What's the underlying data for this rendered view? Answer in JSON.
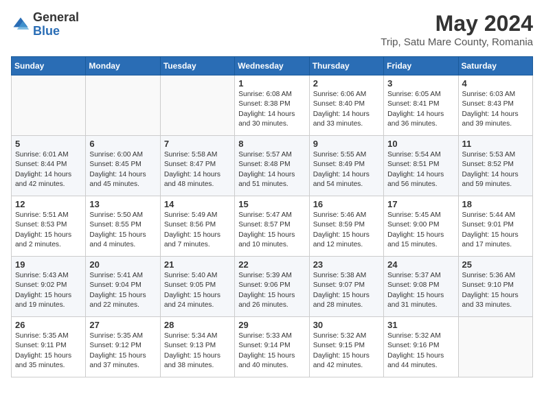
{
  "logo": {
    "general": "General",
    "blue": "Blue"
  },
  "title": "May 2024",
  "subtitle": "Trip, Satu Mare County, Romania",
  "days_of_week": [
    "Sunday",
    "Monday",
    "Tuesday",
    "Wednesday",
    "Thursday",
    "Friday",
    "Saturday"
  ],
  "weeks": [
    [
      {
        "day": "",
        "detail": ""
      },
      {
        "day": "",
        "detail": ""
      },
      {
        "day": "",
        "detail": ""
      },
      {
        "day": "1",
        "detail": "Sunrise: 6:08 AM\nSunset: 8:38 PM\nDaylight: 14 hours\nand 30 minutes."
      },
      {
        "day": "2",
        "detail": "Sunrise: 6:06 AM\nSunset: 8:40 PM\nDaylight: 14 hours\nand 33 minutes."
      },
      {
        "day": "3",
        "detail": "Sunrise: 6:05 AM\nSunset: 8:41 PM\nDaylight: 14 hours\nand 36 minutes."
      },
      {
        "day": "4",
        "detail": "Sunrise: 6:03 AM\nSunset: 8:43 PM\nDaylight: 14 hours\nand 39 minutes."
      }
    ],
    [
      {
        "day": "5",
        "detail": "Sunrise: 6:01 AM\nSunset: 8:44 PM\nDaylight: 14 hours\nand 42 minutes."
      },
      {
        "day": "6",
        "detail": "Sunrise: 6:00 AM\nSunset: 8:45 PM\nDaylight: 14 hours\nand 45 minutes."
      },
      {
        "day": "7",
        "detail": "Sunrise: 5:58 AM\nSunset: 8:47 PM\nDaylight: 14 hours\nand 48 minutes."
      },
      {
        "day": "8",
        "detail": "Sunrise: 5:57 AM\nSunset: 8:48 PM\nDaylight: 14 hours\nand 51 minutes."
      },
      {
        "day": "9",
        "detail": "Sunrise: 5:55 AM\nSunset: 8:49 PM\nDaylight: 14 hours\nand 54 minutes."
      },
      {
        "day": "10",
        "detail": "Sunrise: 5:54 AM\nSunset: 8:51 PM\nDaylight: 14 hours\nand 56 minutes."
      },
      {
        "day": "11",
        "detail": "Sunrise: 5:53 AM\nSunset: 8:52 PM\nDaylight: 14 hours\nand 59 minutes."
      }
    ],
    [
      {
        "day": "12",
        "detail": "Sunrise: 5:51 AM\nSunset: 8:53 PM\nDaylight: 15 hours\nand 2 minutes."
      },
      {
        "day": "13",
        "detail": "Sunrise: 5:50 AM\nSunset: 8:55 PM\nDaylight: 15 hours\nand 4 minutes."
      },
      {
        "day": "14",
        "detail": "Sunrise: 5:49 AM\nSunset: 8:56 PM\nDaylight: 15 hours\nand 7 minutes."
      },
      {
        "day": "15",
        "detail": "Sunrise: 5:47 AM\nSunset: 8:57 PM\nDaylight: 15 hours\nand 10 minutes."
      },
      {
        "day": "16",
        "detail": "Sunrise: 5:46 AM\nSunset: 8:59 PM\nDaylight: 15 hours\nand 12 minutes."
      },
      {
        "day": "17",
        "detail": "Sunrise: 5:45 AM\nSunset: 9:00 PM\nDaylight: 15 hours\nand 15 minutes."
      },
      {
        "day": "18",
        "detail": "Sunrise: 5:44 AM\nSunset: 9:01 PM\nDaylight: 15 hours\nand 17 minutes."
      }
    ],
    [
      {
        "day": "19",
        "detail": "Sunrise: 5:43 AM\nSunset: 9:02 PM\nDaylight: 15 hours\nand 19 minutes."
      },
      {
        "day": "20",
        "detail": "Sunrise: 5:41 AM\nSunset: 9:04 PM\nDaylight: 15 hours\nand 22 minutes."
      },
      {
        "day": "21",
        "detail": "Sunrise: 5:40 AM\nSunset: 9:05 PM\nDaylight: 15 hours\nand 24 minutes."
      },
      {
        "day": "22",
        "detail": "Sunrise: 5:39 AM\nSunset: 9:06 PM\nDaylight: 15 hours\nand 26 minutes."
      },
      {
        "day": "23",
        "detail": "Sunrise: 5:38 AM\nSunset: 9:07 PM\nDaylight: 15 hours\nand 28 minutes."
      },
      {
        "day": "24",
        "detail": "Sunrise: 5:37 AM\nSunset: 9:08 PM\nDaylight: 15 hours\nand 31 minutes."
      },
      {
        "day": "25",
        "detail": "Sunrise: 5:36 AM\nSunset: 9:10 PM\nDaylight: 15 hours\nand 33 minutes."
      }
    ],
    [
      {
        "day": "26",
        "detail": "Sunrise: 5:35 AM\nSunset: 9:11 PM\nDaylight: 15 hours\nand 35 minutes."
      },
      {
        "day": "27",
        "detail": "Sunrise: 5:35 AM\nSunset: 9:12 PM\nDaylight: 15 hours\nand 37 minutes."
      },
      {
        "day": "28",
        "detail": "Sunrise: 5:34 AM\nSunset: 9:13 PM\nDaylight: 15 hours\nand 38 minutes."
      },
      {
        "day": "29",
        "detail": "Sunrise: 5:33 AM\nSunset: 9:14 PM\nDaylight: 15 hours\nand 40 minutes."
      },
      {
        "day": "30",
        "detail": "Sunrise: 5:32 AM\nSunset: 9:15 PM\nDaylight: 15 hours\nand 42 minutes."
      },
      {
        "day": "31",
        "detail": "Sunrise: 5:32 AM\nSunset: 9:16 PM\nDaylight: 15 hours\nand 44 minutes."
      },
      {
        "day": "",
        "detail": ""
      }
    ]
  ]
}
